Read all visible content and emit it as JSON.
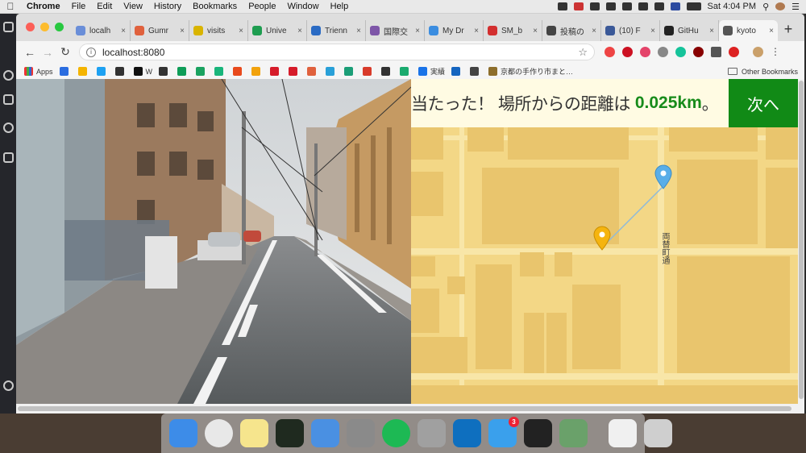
{
  "menubar": {
    "app_name": "Chrome",
    "items": [
      "File",
      "Edit",
      "View",
      "History",
      "Bookmarks",
      "People",
      "Window",
      "Help"
    ],
    "clock": "Sat 4:04 PM"
  },
  "tabs": [
    {
      "title": "localh",
      "color": "#6a8ed8"
    },
    {
      "title": "Gumr",
      "color": "#e0613d"
    },
    {
      "title": "visits",
      "color": "#d9b400"
    },
    {
      "title": "Unive",
      "color": "#1e9d50"
    },
    {
      "title": "Trienn",
      "color": "#2a6bc4"
    },
    {
      "title": "国際交",
      "color": "#7e56a8"
    },
    {
      "title": "My Dr",
      "color": "#3b8de0"
    },
    {
      "title": "SM_b",
      "color": "#d32f2f"
    },
    {
      "title": "投稿の",
      "color": "#444444"
    },
    {
      "title": "(10) F",
      "color": "#3b5998"
    },
    {
      "title": "GitHu",
      "color": "#222222"
    },
    {
      "title": "kyoto",
      "color": "#555555"
    }
  ],
  "address": {
    "url": "localhost:8080"
  },
  "bookmarks": {
    "apps_label": "Apps",
    "items": [
      {
        "label": "",
        "color": "#2b6de0"
      },
      {
        "label": "",
        "color": "#f4b400"
      },
      {
        "label": "",
        "color": "#1da1f2"
      },
      {
        "label": "",
        "color": "#333333"
      },
      {
        "label": "W",
        "color": "#111111"
      },
      {
        "label": "",
        "color": "#333333"
      },
      {
        "label": "",
        "color": "#0f9d58"
      },
      {
        "label": "",
        "color": "#1aa260"
      },
      {
        "label": "",
        "color": "#19b57b"
      },
      {
        "label": "",
        "color": "#e84a1c"
      },
      {
        "label": "",
        "color": "#f2a20c"
      },
      {
        "label": "",
        "color": "#d61c2a"
      },
      {
        "label": "",
        "color": "#d61c2a"
      },
      {
        "label": "",
        "color": "#e0613d"
      },
      {
        "label": "",
        "color": "#29a0d8"
      },
      {
        "label": "",
        "color": "#1b9e77"
      },
      {
        "label": "",
        "color": "#d83b2a"
      },
      {
        "label": "",
        "color": "#333333"
      },
      {
        "label": "",
        "color": "#1aaa6e"
      },
      {
        "label": "実績",
        "color": "#1a73e8"
      },
      {
        "label": "",
        "color": "#1565c0"
      },
      {
        "label": "",
        "color": "#444444"
      },
      {
        "label": "京都の手作り市まと…",
        "color": "#8d6e2c"
      }
    ],
    "other_label": "Other Bookmarks"
  },
  "game": {
    "result_prefix": "当たった！ 場所からの距離は",
    "distance": "0.025km",
    "result_suffix": "。",
    "next_label": "次へ",
    "road_name": "両替町通"
  },
  "dock": {
    "items": [
      {
        "name": "finder",
        "color": "#3d8ce8"
      },
      {
        "name": "chrome",
        "color": "#e8e8e8"
      },
      {
        "name": "notes",
        "color": "#f6e58d"
      },
      {
        "name": "activity-monitor",
        "color": "#1f2a1f"
      },
      {
        "name": "keynote",
        "color": "#4a90e2"
      },
      {
        "name": "system-preferences",
        "color": "#8a8a8a"
      },
      {
        "name": "spotify",
        "color": "#1db954"
      },
      {
        "name": "calculator",
        "color": "#a0a0a0"
      },
      {
        "name": "vscode",
        "color": "#0e6fbf"
      },
      {
        "name": "twitter-client",
        "color": "#3aa0ec",
        "badge": "3"
      },
      {
        "name": "terminal",
        "color": "#222222"
      },
      {
        "name": "preview",
        "color": "#6aa16a"
      },
      {
        "name": "itunes-doc",
        "color": "#f0f0f0"
      },
      {
        "name": "trash",
        "color": "#cfcfcf"
      }
    ]
  }
}
